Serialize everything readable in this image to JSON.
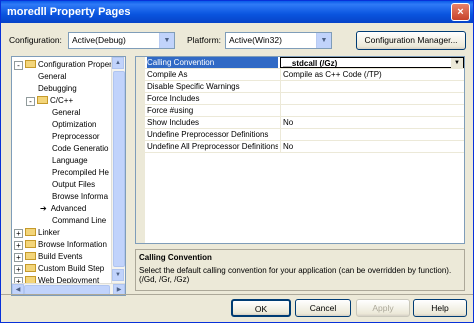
{
  "window": {
    "title": "moredll Property Pages",
    "close_glyph": "×"
  },
  "config": {
    "configuration_label": "Configuration:",
    "configuration_value": "Active(Debug)",
    "platform_label": "Platform:",
    "platform_value": "Active(Win32)",
    "manager_button": "Configuration Manager..."
  },
  "tree": {
    "items": [
      {
        "label": "Configuration Propertie",
        "expander": "-",
        "folder": true
      },
      {
        "label": "General"
      },
      {
        "label": "Debugging"
      },
      {
        "label": "C/C++",
        "expander": "-",
        "folder": true
      },
      {
        "label": "General"
      },
      {
        "label": "Optimization"
      },
      {
        "label": "Preprocessor"
      },
      {
        "label": "Code Generatio"
      },
      {
        "label": "Language"
      },
      {
        "label": "Precompiled He"
      },
      {
        "label": "Output Files"
      },
      {
        "label": "Browse Informa"
      },
      {
        "label": "Advanced",
        "marker": "➔"
      },
      {
        "label": "Command Line"
      },
      {
        "label": "Linker",
        "expander": "+",
        "folder": true
      },
      {
        "label": "Browse Information",
        "expander": "+",
        "folder": true
      },
      {
        "label": "Build Events",
        "expander": "+",
        "folder": true
      },
      {
        "label": "Custom Build Step",
        "expander": "+",
        "folder": true
      },
      {
        "label": "Web Deployment",
        "expander": "+",
        "folder": true
      }
    ]
  },
  "grid": {
    "rows": [
      {
        "name": "Calling Convention",
        "value": "__stdcall (/Gz)"
      },
      {
        "name": "Compile As",
        "value": "Compile as C++ Code (/TP)"
      },
      {
        "name": "Disable Specific Warnings",
        "value": ""
      },
      {
        "name": "Force Includes",
        "value": ""
      },
      {
        "name": "Force #using",
        "value": ""
      },
      {
        "name": "Show Includes",
        "value": "No"
      },
      {
        "name": "Undefine Preprocessor Definitions",
        "value": ""
      },
      {
        "name": "Undefine All Preprocessor Definitions",
        "value": "No"
      }
    ]
  },
  "description": {
    "title": "Calling Convention",
    "text": "Select the default calling convention for your application (can be overridden by function).     (/Gd, /Gr, /Gz)"
  },
  "buttons": {
    "ok": "OK",
    "cancel": "Cancel",
    "apply": "Apply",
    "help": "Help"
  }
}
